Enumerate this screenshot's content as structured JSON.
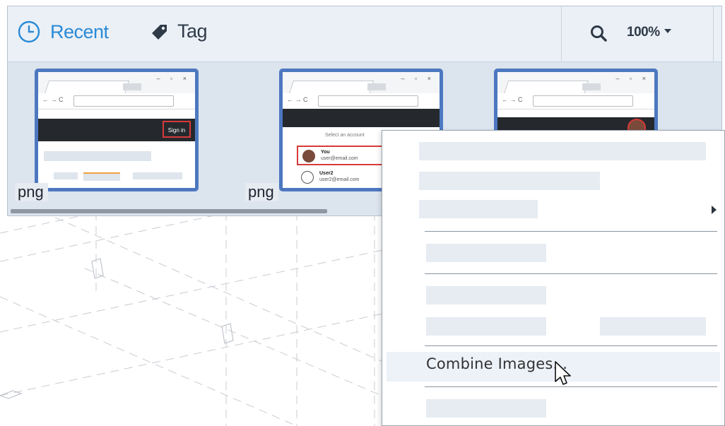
{
  "toolbar": {
    "recent_label": "Recent",
    "tag_label": "Tag",
    "zoom_label": "100%"
  },
  "thumbnails": [
    {
      "ext": "png",
      "signin": "Sign in"
    },
    {
      "ext": "png",
      "select_title": "Select an account",
      "accounts": [
        {
          "name": "You",
          "email": "user@email.com"
        },
        {
          "name": "User2",
          "email": "user2@email.com"
        }
      ]
    },
    {
      "ext": ""
    }
  ],
  "context_menu": {
    "combine_label": "Combine Images..."
  },
  "colors": {
    "accent": "#2a8ad6",
    "thumb_border": "#4d78c0",
    "highlight_red": "#d73a3a",
    "panel_bg": "#dce4ee",
    "menu_highlight": "#edf2f8"
  },
  "icons": {
    "recent": "clock-icon",
    "tag": "tag-icon",
    "search": "search-icon",
    "zoom_caret": "caret-down-icon",
    "submenu": "chevron-right-icon",
    "pointer": "mouse-pointer-icon"
  }
}
